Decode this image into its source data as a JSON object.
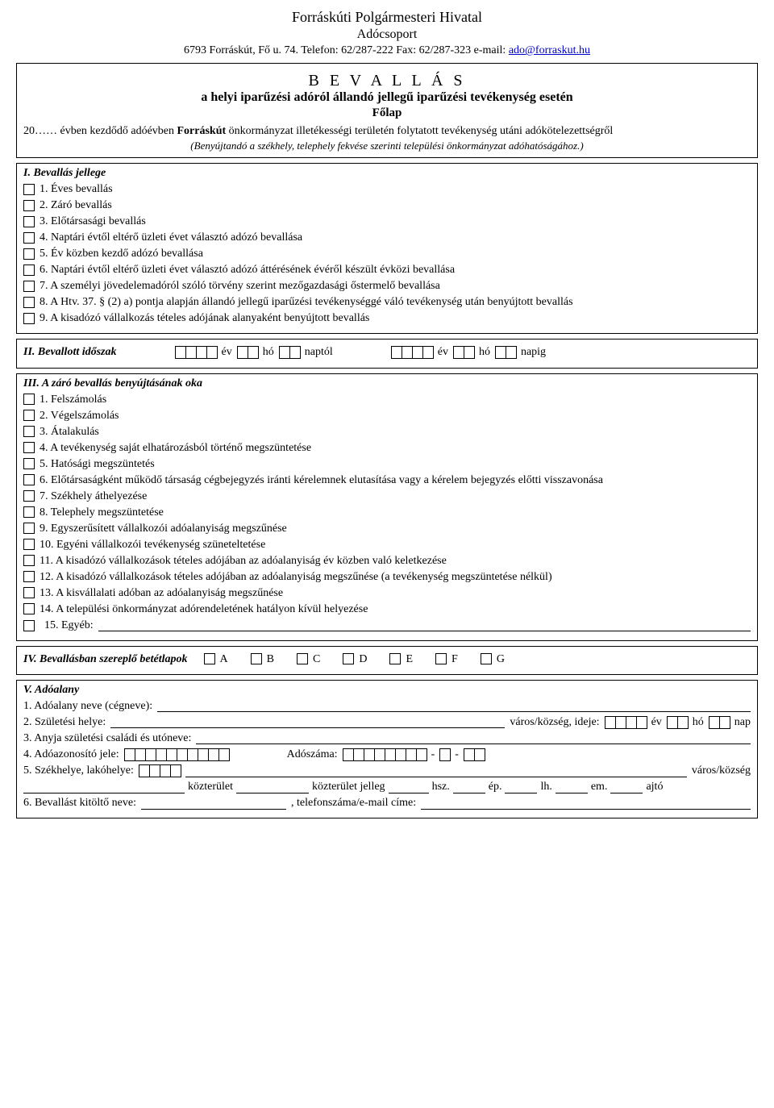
{
  "header": {
    "line1": "Forráskúti Polgármesteri Hivatal",
    "line2": "Adócsoport",
    "line3_pre": "6793 Forráskút, Fő u. 74. Telefon: 62/287-222 Fax: 62/287-323 e-mail: ",
    "email": "ado@forraskut.hu"
  },
  "title": {
    "main": "B E V A L L Á S",
    "sub": "a helyi iparűzési adóról állandó jellegű iparűzési tevékenység esetén",
    "folap": "Főlap"
  },
  "intro": {
    "pre": "20…… évben kezdődő adóévben ",
    "bold": "Forráskút",
    "post": " önkormányzat illetékességi területén folytatott tevékenység utáni adókötelezettségről",
    "note": "(Benyújtandó a székhely, telephely fekvése szerinti települési önkormányzat adóhatóságához.)"
  },
  "section1": {
    "head": "I. Bevallás jellege",
    "items": [
      "1. Éves bevallás",
      "2. Záró bevallás",
      "3. Előtársasági bevallás",
      "4. Naptári évtől eltérő üzleti évet választó adózó bevallása",
      "5. Év közben kezdő adózó bevallása",
      "6. Naptári évtől eltérő üzleti évet választó adózó áttérésének évéről készült évközi bevallása",
      "7. A személyi jövedelemadóról szóló törvény szerint mezőgazdasági őstermelő bevallása",
      "8. A Htv. 37. § (2) a) pontja alapján állandó jellegű iparűzési tevékenységgé váló tevékenység után benyújtott bevallás",
      "9. A kisadózó vállalkozás tételes adójának alanyaként benyújtott bevallás"
    ]
  },
  "section2": {
    "head": "II. Bevallott időszak",
    "ev": "év",
    "ho": "hó",
    "naptol": "naptól",
    "napig": "napig"
  },
  "section3": {
    "head": "III. A záró bevallás benyújtásának oka",
    "items": [
      "1. Felszámolás",
      "2. Végelszámolás",
      "3. Átalakulás",
      "4. A tevékenység saját elhatározásból történő megszüntetése",
      "5. Hatósági megszüntetés",
      "6. Előtársaságként működő társaság cégbejegyzés iránti kérelemnek elutasítása vagy a kérelem bejegyzés előtti visszavonása",
      "7. Székhely áthelyezése",
      "8. Telephely megszüntetése",
      "9. Egyszerűsített vállalkozói adóalanyiság megszűnése",
      "10. Egyéni vállalkozói tevékenység szüneteltetése",
      "11. A kisadózó vállalkozások tételes adójában az adóalanyiság év közben való keletkezése",
      "12. A kisadózó vállalkozások tételes adójában az adóalanyiság megszűnése (a tevékenység megszüntetése nélkül)",
      "13. A kisvállalati adóban az adóalanyiság megszűnése",
      "14. A települési önkormányzat adórendeletének hatályon kívül helyezése"
    ],
    "egyeb": "15. Egyéb:"
  },
  "section4": {
    "head": "IV. Bevallásban szereplő betétlapok",
    "letters": [
      "A",
      "B",
      "C",
      "D",
      "E",
      "F",
      "G"
    ]
  },
  "section5": {
    "head": "V. Adóalany",
    "l1": "1. Adóalany neve (cégneve): ",
    "l2a": "2. Születési helye: ",
    "l2b": "város/község, ideje:",
    "ev": "év",
    "ho": "hó",
    "nap": "nap",
    "l3": "3. Anyja születési családi és utóneve: ",
    "l4a": "4. Adóazonosító jele:",
    "l4b": "Adószáma:",
    "l5a": "5. Székhelye, lakóhelye:",
    "l5b": "város/község",
    "l5c_kozt": "közterület",
    "l5c_jelleg": "közterület jelleg",
    "l5c_hsz": "hsz.",
    "l5c_ep": "ép.",
    "l5c_lh": "lh.",
    "l5c_em": "em.",
    "l5c_ajto": "ajtó",
    "l6a": "6. Bevallást kitöltő neve:",
    "l6b": ", telefonszáma/e-mail címe:"
  }
}
